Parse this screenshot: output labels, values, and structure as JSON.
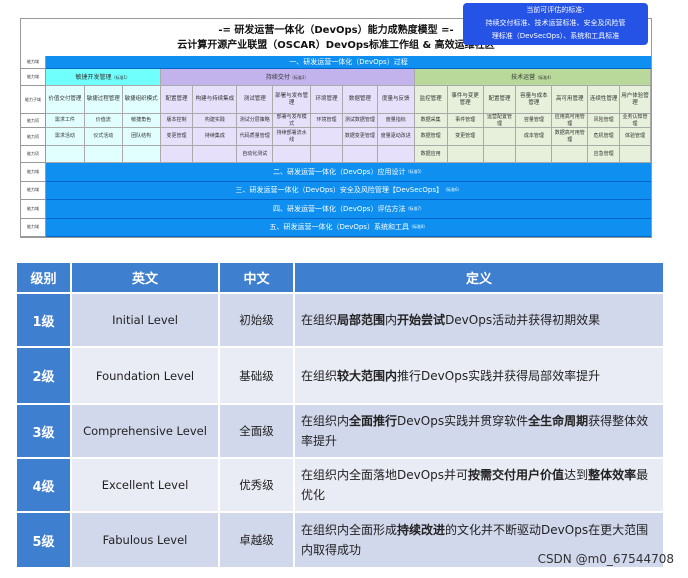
{
  "diagram": {
    "title1": "-= 研发运营一体化（DevOps）能力成熟度模型 =-",
    "title2": "云计算开源产业联盟（OSCAR）DevOps标准工作组 & 高效运维社区",
    "popup": {
      "title": "当前可评估的标准:",
      "line1": "持续交付标准、技术运营标准、安全及风险管",
      "line2": "理标准（DevSecOps）、系统和工具标准"
    },
    "labels": {
      "domain": "能力域",
      "subdomain": "能力子域",
      "item": "能力项"
    },
    "process": "一、研发运营一体化（DevOps）过程",
    "groups": [
      {
        "name": "敏捷开发管理",
        "tag": "（标准1）"
      },
      {
        "name": "持续交付",
        "tag": "（标准2）"
      },
      {
        "name": "技术运营",
        "tag": "（标准4）"
      }
    ],
    "columns": [
      {
        "h": "价值交付管理",
        "items": [
          "需求工件",
          "需求活动",
          ""
        ]
      },
      {
        "h": "敏捷过程管理",
        "items": [
          "价值流",
          "仪式活动",
          ""
        ]
      },
      {
        "h": "敏捷组织模式",
        "items": [
          "敏捷角色",
          "团队结构",
          ""
        ]
      },
      {
        "h": "配置管理",
        "items": [
          "版本控制",
          "变更管理",
          ""
        ]
      },
      {
        "h": "构建与持续集成",
        "items": [
          "构建实践",
          "持续集成",
          ""
        ]
      },
      {
        "h": "测试管理",
        "items": [
          "测试分层策略",
          "代码质量管理",
          "自动化测试"
        ]
      },
      {
        "h": "部署与发布管理",
        "items": [
          "部署与发布模式",
          "持续部署流水线",
          ""
        ]
      },
      {
        "h": "环境管理",
        "items": [
          "环境管理",
          "",
          ""
        ]
      },
      {
        "h": "数据管理",
        "items": [
          "测试数据管理",
          "数据变更管理",
          ""
        ]
      },
      {
        "h": "度量与反馈",
        "items": [
          "度量指标",
          "度量驱动改进",
          ""
        ]
      },
      {
        "h": "监控管理",
        "items": [
          "数据采集",
          "数据管理",
          "数据应用"
        ]
      },
      {
        "h": "事件与变更管理",
        "items": [
          "事件管理",
          "变更管理",
          ""
        ]
      },
      {
        "h": "配置管理",
        "items": [
          "运营配置管理",
          "",
          ""
        ]
      },
      {
        "h": "容量与成本管理",
        "items": [
          "容量管理",
          "成本管理",
          ""
        ]
      },
      {
        "h": "高可用管理",
        "items": [
          "应用高可用管理",
          "数据高可用管理",
          ""
        ]
      },
      {
        "h": "连续性管理",
        "items": [
          "风险管理",
          "危机管理",
          "应急管理"
        ]
      },
      {
        "h": "用户体验管理",
        "items": [
          "业务认知管理",
          "体验管理",
          ""
        ]
      }
    ],
    "bars": [
      {
        "text": "二、研发运营一体化（DevOps）应用设计",
        "tag": "（标准5）"
      },
      {
        "text": "三、研发运营一体化（DevOps）安全及风险管理【DevSecOps】",
        "tag": "（标准6）"
      },
      {
        "text": "四、研发运营一体化（DevOps）评估方法",
        "tag": "（标准7）"
      },
      {
        "text": "五、研发运营一体化（DevOps）系统和工具",
        "tag": "（标准8）"
      }
    ]
  },
  "table": {
    "headers": [
      "级别",
      "英文",
      "中文",
      "定义"
    ],
    "rows": [
      {
        "level": "1级",
        "en": "Initial Level",
        "cn": "初始级",
        "def": [
          {
            "t": "在组织",
            "b": false
          },
          {
            "t": "局部范围",
            "b": true
          },
          {
            "t": "内",
            "b": false
          },
          {
            "t": "开始尝试",
            "b": true
          },
          {
            "t": "DevOps活动并获得初期效果",
            "b": false
          }
        ]
      },
      {
        "level": "2级",
        "en": "Foundation Level",
        "cn": "基础级",
        "def": [
          {
            "t": "在组织",
            "b": false
          },
          {
            "t": "较大范围内",
            "b": true
          },
          {
            "t": "推行DevOps实践并获得局部效率提升",
            "b": false
          }
        ]
      },
      {
        "level": "3级",
        "en": "Comprehensive Level",
        "cn": "全面级",
        "def": [
          {
            "t": "在组织内",
            "b": false
          },
          {
            "t": "全面推行",
            "b": true
          },
          {
            "t": "DevOps实践并贯穿软件",
            "b": false
          },
          {
            "t": "全生命周期",
            "b": true
          },
          {
            "t": "获得整体效率提升",
            "b": false
          }
        ]
      },
      {
        "level": "4级",
        "en": "Excellent Level",
        "cn": "优秀级",
        "def": [
          {
            "t": "在组织内全面落地DevOps并可",
            "b": false
          },
          {
            "t": "按需交付用户价值",
            "b": true
          },
          {
            "t": "达到",
            "b": false
          },
          {
            "t": "整体效率",
            "b": true
          },
          {
            "t": "最优化",
            "b": false
          }
        ]
      },
      {
        "level": "5级",
        "en": "Fabulous Level",
        "cn": "卓越级",
        "def": [
          {
            "t": "在组织内全面形成",
            "b": false
          },
          {
            "t": "持续改进",
            "b": true
          },
          {
            "t": "的文化并不断驱动DevOps在更大范围内取得成功",
            "b": false
          }
        ]
      }
    ]
  },
  "watermark": "CSDN @m0_67544708"
}
